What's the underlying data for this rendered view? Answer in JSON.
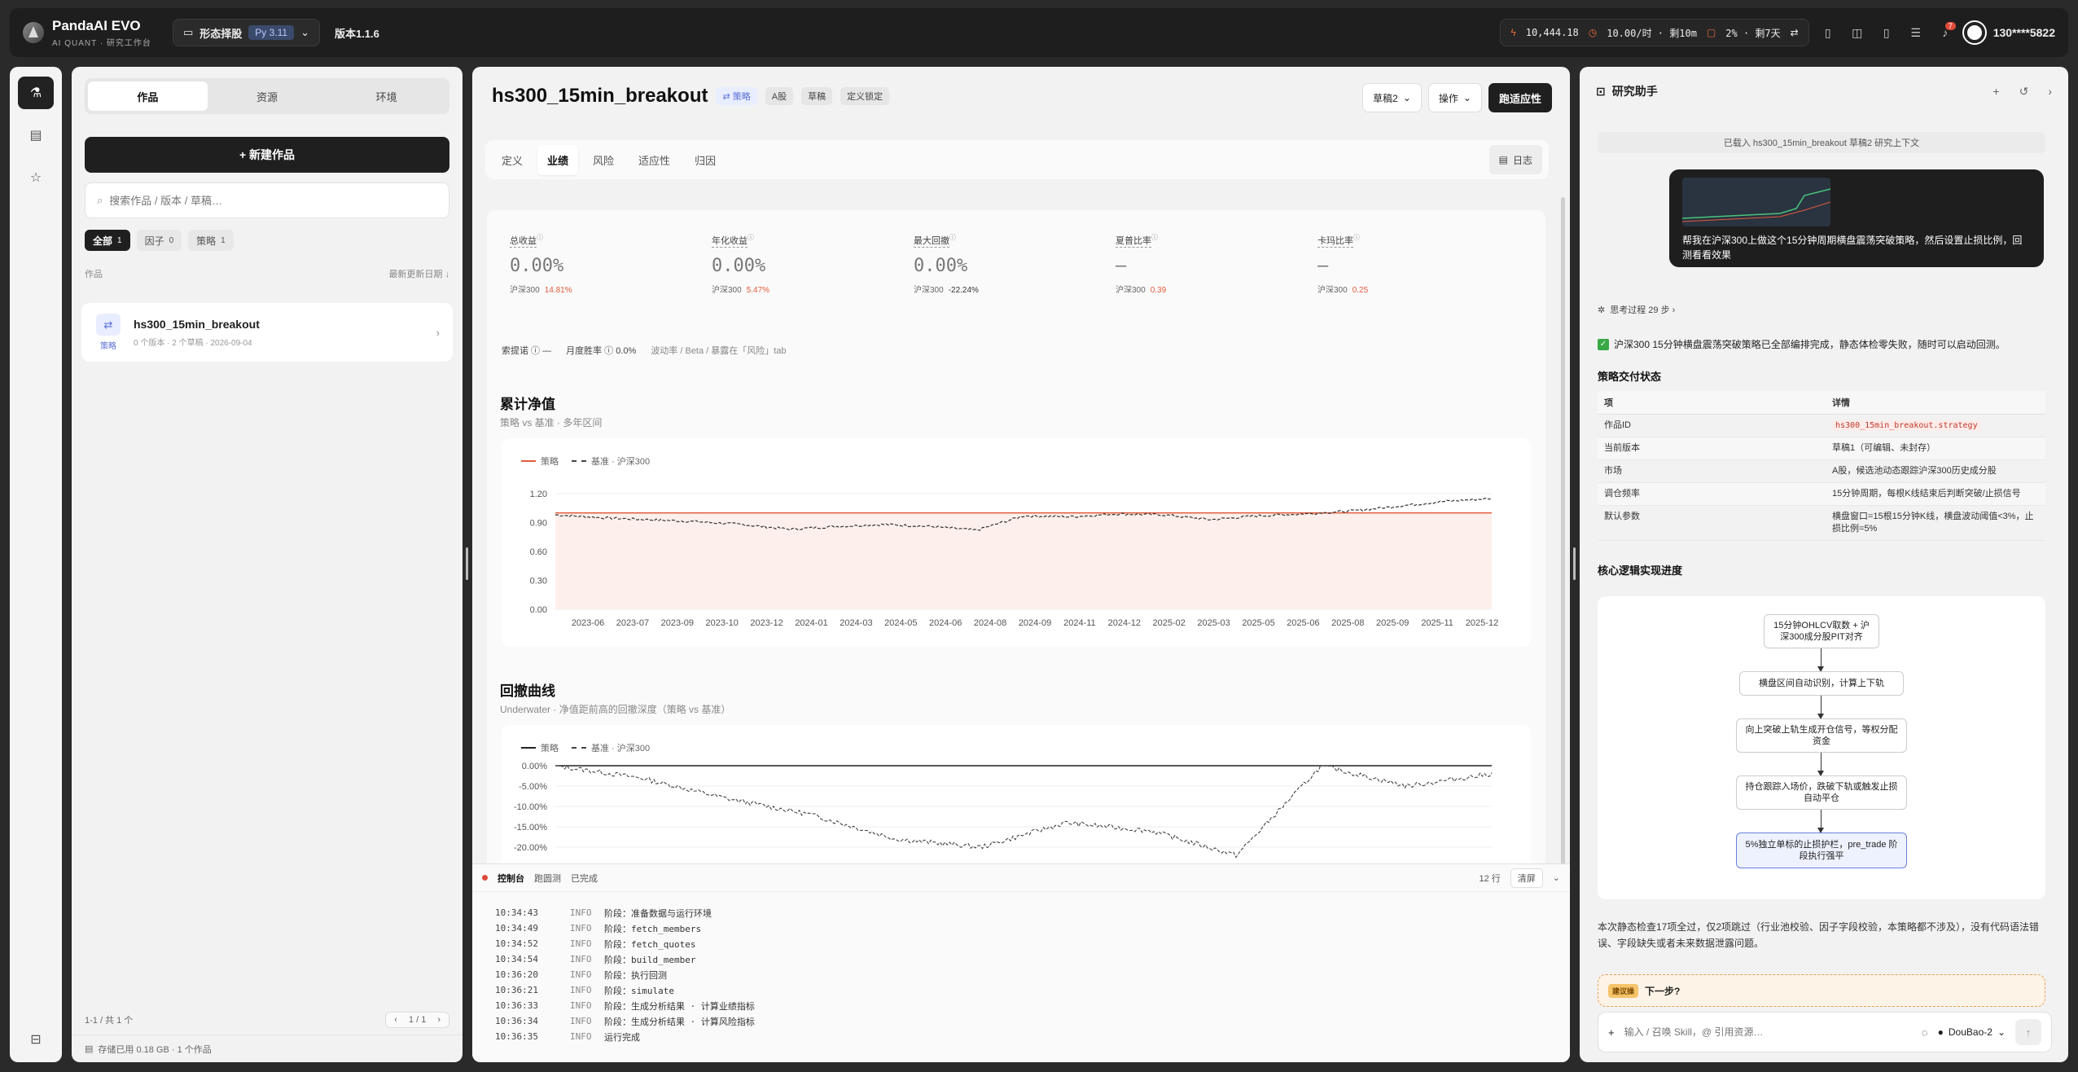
{
  "app": {
    "name": "PandaAI EVO",
    "subtitle": "AI QUANT · 研究工作台",
    "project": "形态择股",
    "python": "Py 3.11",
    "version": "版本1.1.6"
  },
  "topstats": {
    "balance": "10,444.18",
    "rate": "10.00/时 · 剩10m",
    "pct": "2% · 剩7天",
    "notif_count": "7",
    "user": "130****5822"
  },
  "rail": {
    "items": [
      "flask-icon",
      "book-icon",
      "star-icon"
    ],
    "bottom": "bag-icon"
  },
  "sidebar": {
    "tabs": [
      "作品",
      "资源",
      "环境"
    ],
    "new_button": "+ 新建作品",
    "search_placeholder": "搜索作品 / 版本 / 草稿…",
    "filters": [
      {
        "label": "全部",
        "count": "1"
      },
      {
        "label": "因子",
        "count": "0"
      },
      {
        "label": "策略",
        "count": "1"
      }
    ],
    "list_header": "作品",
    "sort_label": "最新更新日期 ↓",
    "works": [
      {
        "title": "hs300_15min_breakout",
        "meta": "0 个版本 · 2 个草稿 · 2026-09-04",
        "type": "策略"
      }
    ],
    "pager_text": "1-1 / 共 1 个",
    "page": "1 / 1",
    "storage": "存储已用 0.18 GB · 1 个作品"
  },
  "main": {
    "title": "hs300_15min_breakout",
    "tags": [
      "策略",
      "A股",
      "草稿",
      "定义锁定"
    ],
    "draft_select": "草稿2",
    "ops": "操作",
    "run": "跑适应性",
    "tabs": [
      "定义",
      "业绩",
      "风险",
      "适应性",
      "归因"
    ],
    "active_tab": "业绩",
    "log_button": "日志",
    "kpis": [
      {
        "label": "总收益",
        "value": "0.00%",
        "bench": "沪深300",
        "bench_val": "14.81%",
        "neg": false
      },
      {
        "label": "年化收益",
        "value": "0.00%",
        "bench": "沪深300",
        "bench_val": "5.47%",
        "neg": false
      },
      {
        "label": "最大回撤",
        "value": "0.00%",
        "bench": "沪深300",
        "bench_val": "-22.24%",
        "neg": true
      },
      {
        "label": "夏普比率",
        "value": "—",
        "bench": "沪深300",
        "bench_val": "0.39",
        "neg": false
      },
      {
        "label": "卡玛比率",
        "value": "—",
        "bench": "沪深300",
        "bench_val": "0.25",
        "neg": false
      }
    ],
    "subkpis": {
      "sortino": "索提诺 ⓘ —",
      "monthly": "月度胜率 ⓘ 0.0%",
      "note": "波动率 / Beta / 暴露在「风险」tab"
    },
    "nav_chart": {
      "title": "累计净值",
      "subtitle": "策略 vs 基准 · 多年区间"
    },
    "dd_chart": {
      "title": "回撤曲线",
      "subtitle": "Underwater · 净值距前高的回撤深度（策略 vs 基准）"
    },
    "console": {
      "tabs": [
        "控制台",
        "跑圆测",
        "已完成"
      ],
      "lines_count": "12 行",
      "clear": "清屏",
      "lines": [
        {
          "t": "10:34:43",
          "lv": "INFO",
          "msg": "阶段：准备数据与运行环境"
        },
        {
          "t": "10:34:49",
          "lv": "INFO",
          "msg": "阶段：fetch_members"
        },
        {
          "t": "10:34:52",
          "lv": "INFO",
          "msg": "阶段：fetch_quotes"
        },
        {
          "t": "10:34:54",
          "lv": "INFO",
          "msg": "阶段：build_member"
        },
        {
          "t": "10:36:20",
          "lv": "INFO",
          "msg": "阶段：执行回测"
        },
        {
          "t": "10:36:21",
          "lv": "INFO",
          "msg": "阶段：simulate"
        },
        {
          "t": "10:36:33",
          "lv": "INFO",
          "msg": "阶段：生成分析结果 · 计算业绩指标"
        },
        {
          "t": "10:36:34",
          "lv": "INFO",
          "msg": "阶段：生成分析结果 · 计算风险指标"
        },
        {
          "t": "10:36:35",
          "lv": "INFO",
          "msg": "运行完成"
        }
      ]
    }
  },
  "chart_data": [
    {
      "type": "line",
      "title": "累计净值",
      "x": [
        "2023-06",
        "2023-07",
        "2023-09",
        "2023-10",
        "2023-12",
        "2024-01",
        "2024-03",
        "2024-05",
        "2024-06",
        "2024-08",
        "2024-09",
        "2024-11",
        "2024-12",
        "2025-02",
        "2025-03",
        "2025-05",
        "2025-06",
        "2025-08",
        "2025-09",
        "2025-11",
        "2025-12"
      ],
      "series": [
        {
          "name": "策略",
          "values": [
            1,
            1,
            1,
            1,
            1,
            1,
            1,
            1,
            1,
            1,
            1,
            1,
            1,
            1,
            1,
            1,
            1,
            1,
            1,
            1,
            1
          ]
        },
        {
          "name": "基准 · 沪深300",
          "values": [
            0.98,
            0.95,
            0.93,
            0.91,
            0.88,
            0.83,
            0.86,
            0.88,
            0.86,
            0.82,
            0.97,
            0.96,
            0.99,
            0.98,
            0.93,
            0.97,
            0.99,
            1.02,
            1.07,
            1.12,
            1.15
          ]
        }
      ],
      "ylim": [
        0,
        1.2
      ],
      "yticks": [
        "1.20",
        "0.90",
        "0.60",
        "0.30",
        "0.00"
      ],
      "legend": "top-left"
    },
    {
      "type": "line",
      "title": "回撤曲线",
      "series": [
        {
          "name": "策略",
          "values": [
            0,
            0,
            0,
            0,
            0,
            0,
            0,
            0,
            0,
            0,
            0,
            0
          ]
        },
        {
          "name": "基准 · 沪深300",
          "values": [
            0,
            -0.03,
            -0.08,
            -0.12,
            -0.18,
            -0.2,
            -0.14,
            -0.16,
            -0.22,
            0,
            -0.05,
            -0.02
          ]
        }
      ],
      "ylim": [
        -0.22,
        0
      ],
      "yticks": [
        "0.00%",
        "-5.00%",
        "-10.00%",
        "-15.00%",
        "-20.00%"
      ],
      "legend": "top-left"
    }
  ],
  "assistant": {
    "title": "研究助手",
    "context_note": "已载入 hs300_15min_breakout 草稿2 研究上下文",
    "user_msg": "帮我在沪深300上做这个15分钟周期横盘震荡突破策略，然后设置止损比例，回测看看效果",
    "thinking": "思考过程 29 步 ›",
    "done": "沪深300 15分钟横盘震荡突破策略已全部编排完成，静态体检零失败，随时可以启动回测。",
    "delivery_title": "策略交付状态",
    "table_head": [
      "项",
      "详情"
    ],
    "table_rows": [
      [
        "作品ID",
        "hs300_15min_breakout.strategy"
      ],
      [
        "当前版本",
        "草稿1（可编辑、未封存）"
      ],
      [
        "市场",
        "A股，候选池动态跟踪沪深300历史成分股"
      ],
      [
        "调仓频率",
        "15分钟周期，每根K线结束后判断突破/止损信号"
      ],
      [
        "默认参数",
        "横盘窗口=15根15分钟K线，横盘波动阈值<3%，止损比例=5%"
      ]
    ],
    "logic_title": "核心逻辑实现进度",
    "flow": [
      "15分钟OHLCV取数 + 沪深300成分股PIT对齐",
      "横盘区间自动识别，计算上下轨",
      "向上突破上轨生成开仓信号，等权分配资金",
      "持仓跟踪入场价，跌破下轨或触发止损自动平仓",
      "5%独立单标的止损护栏，pre_trade 阶段执行强平"
    ],
    "summary": "本次静态检查17项全过，仅2项跳过（行业池校验、因子字段校验，本策略都不涉及），没有代码语法错误、字段缺失或者未来数据泄露问题。",
    "next_pill": "建议操",
    "next": "下一步?",
    "input_placeholder": "输入 / 召唤 Skill，@ 引用资源…",
    "model": "DouBao-2"
  }
}
